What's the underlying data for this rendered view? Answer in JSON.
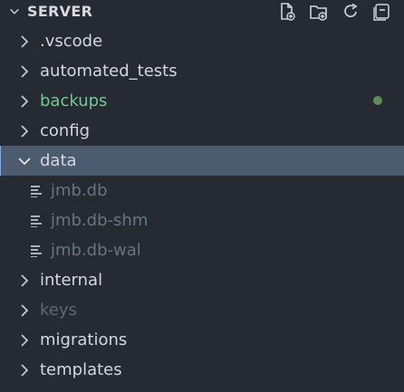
{
  "explorer": {
    "title": "SERVER",
    "actions": [
      {
        "name": "new-file",
        "icon": "new-file-icon"
      },
      {
        "name": "new-folder",
        "icon": "new-folder-icon"
      },
      {
        "name": "refresh",
        "icon": "refresh-icon"
      },
      {
        "name": "collapse-all",
        "icon": "collapse-all-icon"
      }
    ],
    "items": [
      {
        "label": ".vscode",
        "type": "folder",
        "expanded": false
      },
      {
        "label": "automated_tests",
        "type": "folder",
        "expanded": false
      },
      {
        "label": "backups",
        "type": "folder",
        "expanded": false,
        "status": "untracked"
      },
      {
        "label": "config",
        "type": "folder",
        "expanded": false
      },
      {
        "label": "data",
        "type": "folder",
        "expanded": true,
        "selected": true
      },
      {
        "label": "jmb.db",
        "type": "file",
        "status": "ignored"
      },
      {
        "label": "jmb.db-shm",
        "type": "file",
        "status": "ignored"
      },
      {
        "label": "jmb.db-wal",
        "type": "file",
        "status": "ignored"
      },
      {
        "label": "internal",
        "type": "folder",
        "expanded": false
      },
      {
        "label": "keys",
        "type": "folder",
        "expanded": false,
        "status": "ignored"
      },
      {
        "label": "migrations",
        "type": "folder",
        "expanded": false
      },
      {
        "label": "templates",
        "type": "folder",
        "expanded": false
      }
    ]
  },
  "colors": {
    "background": "#262a33",
    "selected_row": "#4c5c6e",
    "text": "#d4d7dd",
    "ignored_text": "#5f6673",
    "untracked_text": "#73c991",
    "git_dot": "#5f8c5b"
  }
}
